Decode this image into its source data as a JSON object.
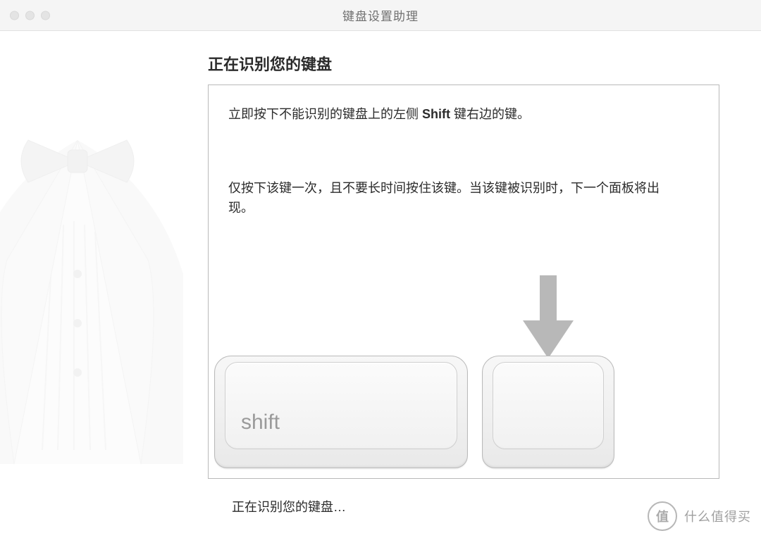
{
  "window": {
    "title": "键盘设置助理"
  },
  "main": {
    "heading": "正在识别您的键盘",
    "instruction_prefix": "立即按下不能识别的键盘上的左侧 ",
    "instruction_key": "Shift",
    "instruction_suffix": " 键右边的键。",
    "instruction_detail": "仅按下该键一次，且不要长时间按住该键。当该键被识别时，下一个面板将出现。",
    "shift_key_label": "shift",
    "status": "正在识别您的键盘…"
  },
  "watermark": {
    "badge": "值",
    "text": "什么值得买"
  }
}
